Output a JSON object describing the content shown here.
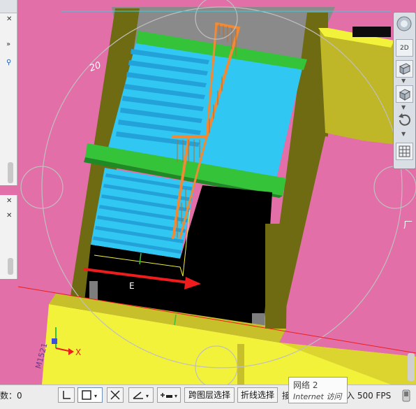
{
  "viewport": {
    "label_room_id": "20",
    "label_door_code": "M1521",
    "label_small": "E",
    "label_factory": "厂",
    "axis_x_label": "X",
    "colors": {
      "wall_pink": "#e36fa9",
      "wall_olive": "#6e6a10",
      "wall_yellow": "#f2f23a",
      "stair_blue": "#31b6ee",
      "floor_green": "#35c33a",
      "railing_orange": "#f08a35",
      "pit_black": "#000000",
      "arrow_red": "#ee1c1c"
    }
  },
  "navbar": {
    "buttons": [
      "full-navigation-wheel-icon",
      "2d-view-icon",
      "cube-view-icon",
      "box-view-icon",
      "orbit-icon",
      "layer-grid-icon"
    ],
    "label_2d": "2D"
  },
  "statusbar": {
    "left_label": "数：0",
    "cross_layer_select": "跨图层选择",
    "polyline_select": "折线选择",
    "truncated_left": "接",
    "fps_text": "输入 500 FPS",
    "tooltip_network": "网络  2",
    "tooltip_internet": "Internet 访问"
  }
}
